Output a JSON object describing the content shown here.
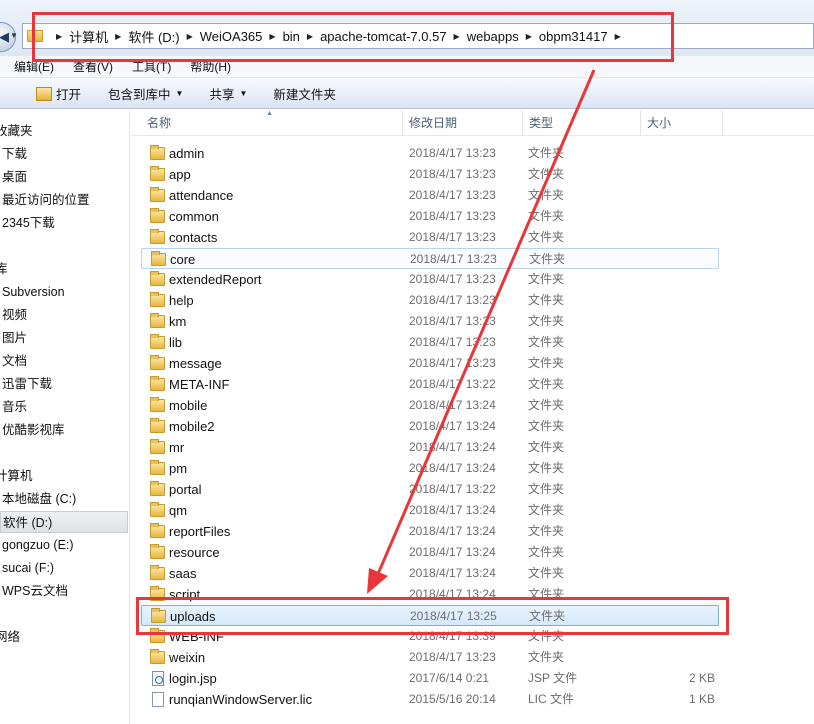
{
  "address": {
    "crumbs": [
      "计算机",
      "软件 (D:)",
      "WeiOA365",
      "bin",
      "apache-tomcat-7.0.57",
      "webapps",
      "obpm31417"
    ]
  },
  "menu": [
    "编辑(E)",
    "查看(V)",
    "工具(T)",
    "帮助(H)"
  ],
  "toolbar": {
    "open": "打开",
    "include_library": "包含到库中",
    "share": "共享",
    "new_folder": "新建文件夹"
  },
  "nav": [
    "收藏夹",
    "下载",
    "桌面",
    "最近访问的位置",
    "2345下载",
    "库",
    "Subversion",
    "视频",
    "图片",
    "文档",
    "迅雷下载",
    "音乐",
    "优酷影视库",
    "计算机",
    "本地磁盘 (C:)",
    "软件 (D:)",
    "gongzuo (E:)",
    "sucai (F:)",
    "WPS云文档",
    "网络"
  ],
  "columns": {
    "name": "名称",
    "date": "修改日期",
    "type": "类型",
    "size": "大小"
  },
  "files": [
    {
      "name": "admin",
      "date": "2018/4/17 13:23",
      "type": "文件夹",
      "size": "",
      "kind": "folder"
    },
    {
      "name": "app",
      "date": "2018/4/17 13:23",
      "type": "文件夹",
      "size": "",
      "kind": "folder"
    },
    {
      "name": "attendance",
      "date": "2018/4/17 13:23",
      "type": "文件夹",
      "size": "",
      "kind": "folder"
    },
    {
      "name": "common",
      "date": "2018/4/17 13:23",
      "type": "文件夹",
      "size": "",
      "kind": "folder"
    },
    {
      "name": "contacts",
      "date": "2018/4/17 13:23",
      "type": "文件夹",
      "size": "",
      "kind": "folder"
    },
    {
      "name": "core",
      "date": "2018/4/17 13:23",
      "type": "文件夹",
      "size": "",
      "kind": "folder"
    },
    {
      "name": "extendedReport",
      "date": "2018/4/17 13:23",
      "type": "文件夹",
      "size": "",
      "kind": "folder"
    },
    {
      "name": "help",
      "date": "2018/4/17 13:23",
      "type": "文件夹",
      "size": "",
      "kind": "folder"
    },
    {
      "name": "km",
      "date": "2018/4/17 13:23",
      "type": "文件夹",
      "size": "",
      "kind": "folder"
    },
    {
      "name": "lib",
      "date": "2018/4/17 13:23",
      "type": "文件夹",
      "size": "",
      "kind": "folder"
    },
    {
      "name": "message",
      "date": "2018/4/17 13:23",
      "type": "文件夹",
      "size": "",
      "kind": "folder"
    },
    {
      "name": "META-INF",
      "date": "2018/4/17 13:22",
      "type": "文件夹",
      "size": "",
      "kind": "folder"
    },
    {
      "name": "mobile",
      "date": "2018/4/17 13:24",
      "type": "文件夹",
      "size": "",
      "kind": "folder"
    },
    {
      "name": "mobile2",
      "date": "2018/4/17 13:24",
      "type": "文件夹",
      "size": "",
      "kind": "folder"
    },
    {
      "name": "mr",
      "date": "2018/4/17 13:24",
      "type": "文件夹",
      "size": "",
      "kind": "folder"
    },
    {
      "name": "pm",
      "date": "2018/4/17 13:24",
      "type": "文件夹",
      "size": "",
      "kind": "folder"
    },
    {
      "name": "portal",
      "date": "2018/4/17 13:22",
      "type": "文件夹",
      "size": "",
      "kind": "folder"
    },
    {
      "name": "qm",
      "date": "2018/4/17 13:24",
      "type": "文件夹",
      "size": "",
      "kind": "folder"
    },
    {
      "name": "reportFiles",
      "date": "2018/4/17 13:24",
      "type": "文件夹",
      "size": "",
      "kind": "folder"
    },
    {
      "name": "resource",
      "date": "2018/4/17 13:24",
      "type": "文件夹",
      "size": "",
      "kind": "folder"
    },
    {
      "name": "saas",
      "date": "2018/4/17 13:24",
      "type": "文件夹",
      "size": "",
      "kind": "folder"
    },
    {
      "name": "script",
      "date": "2018/4/17 13:24",
      "type": "文件夹",
      "size": "",
      "kind": "folder"
    },
    {
      "name": "uploads",
      "date": "2018/4/17 13:25",
      "type": "文件夹",
      "size": "",
      "kind": "folder"
    },
    {
      "name": "WEB-INF",
      "date": "2018/4/17 13:39",
      "type": "文件夹",
      "size": "",
      "kind": "folder"
    },
    {
      "name": "weixin",
      "date": "2018/4/17 13:23",
      "type": "文件夹",
      "size": "",
      "kind": "folder"
    },
    {
      "name": "login.jsp",
      "date": "2017/6/14 0:21",
      "type": "JSP 文件",
      "size": "2 KB",
      "kind": "jsp"
    },
    {
      "name": "runqianWindowServer.lic",
      "date": "2015/5/16 20:14",
      "type": "LIC 文件",
      "size": "1 KB",
      "kind": "file"
    }
  ],
  "selected_file": "uploads",
  "hover_file": "core",
  "selected_nav": "软件 (D:)",
  "colors": {
    "annotation": "#e8363a",
    "selection": "#d6e8fb"
  }
}
